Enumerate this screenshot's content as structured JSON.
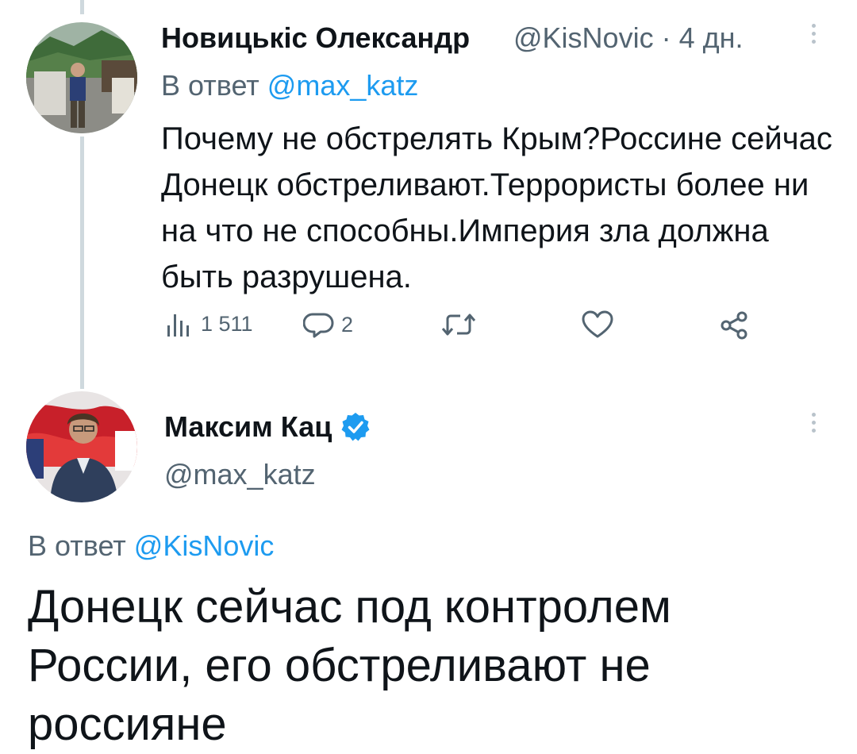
{
  "reply_tweet": {
    "author_name": "Новицькіс Олександр",
    "author_handle": "@KisNovic",
    "separator": "·",
    "time_ago": "4 дн.",
    "reply_to_prefix": "В ответ",
    "reply_to_handle": "@max_katz",
    "text": "Почему не обстрелять Крым?Россине сейчас Донецк обстреливают.Террористы более ни на что не способны.Империя зла должна быть разрушена.",
    "views_count": "1 511",
    "replies_count": "2",
    "icons": [
      "views-icon",
      "reply-icon",
      "retweet-icon",
      "like-icon",
      "share-icon",
      "more-icon"
    ]
  },
  "main_tweet": {
    "author_name": "Максим Кац",
    "verified": true,
    "author_handle": "@max_katz",
    "reply_to_prefix": "В ответ",
    "reply_to_handle": "@KisNovic",
    "text": "Донецк сейчас под контролем России, его обстреливают не россияне",
    "icons": [
      "verified-badge-icon",
      "more-icon"
    ]
  },
  "colors": {
    "accent": "#1d9bf0",
    "text": "#0f1419",
    "secondary": "#536471",
    "thread_line": "#cfd9de"
  }
}
